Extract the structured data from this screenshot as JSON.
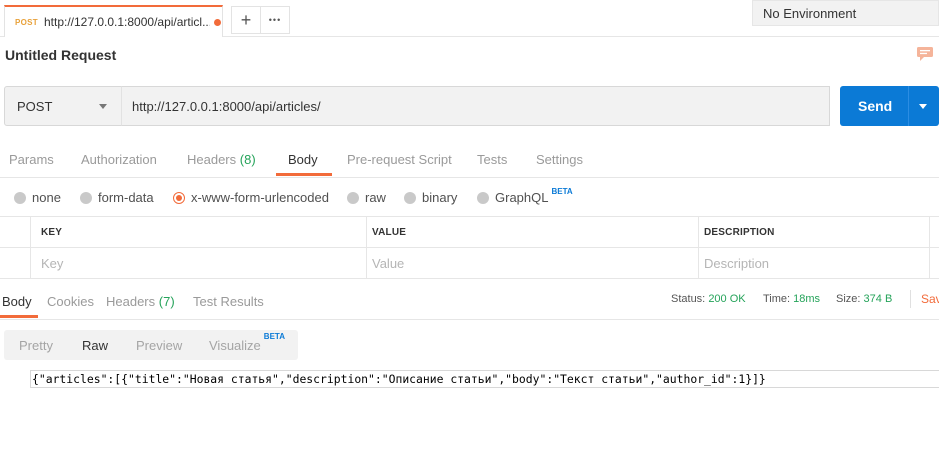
{
  "tab": {
    "method": "POST",
    "url": "http://127.0.0.1:8000/api/articl..."
  },
  "tab_actions": {
    "new_tab": "+",
    "more": "•••"
  },
  "environment": "No Environment",
  "request": {
    "title": "Untitled Request",
    "method": "POST",
    "url": "http://127.0.0.1:8000/api/articles/",
    "send_label": "Send"
  },
  "request_tabs": {
    "params": "Params",
    "authorization": "Authorization",
    "headers": "Headers",
    "headers_count": "(8)",
    "body": "Body",
    "prerequest": "Pre-request Script",
    "tests": "Tests",
    "settings": "Settings"
  },
  "body_types": {
    "none": "none",
    "form_data": "form-data",
    "urlencoded": "x-www-form-urlencoded",
    "raw": "raw",
    "binary": "binary",
    "graphql": "GraphQL",
    "beta": "BETA",
    "selected": "x-www-form-urlencoded"
  },
  "params_table": {
    "headers": {
      "key": "KEY",
      "value": "VALUE",
      "description": "DESCRIPTION"
    },
    "placeholders": {
      "key": "Key",
      "value": "Value",
      "description": "Description"
    }
  },
  "response_tabs": {
    "body": "Body",
    "cookies": "Cookies",
    "headers": "Headers",
    "headers_count": "(7)",
    "test_results": "Test Results"
  },
  "response_status": {
    "status_label": "Status:",
    "status_value": "200 OK",
    "time_label": "Time:",
    "time_value": "18ms",
    "size_label": "Size:",
    "size_value": "374 B",
    "save": "Sav"
  },
  "format_tabs": {
    "pretty": "Pretty",
    "raw": "Raw",
    "preview": "Preview",
    "visualize": "Visualize",
    "beta": "BETA"
  },
  "response_body": "{\"articles\":[{\"title\":\"Новая статья\",\"description\":\"Описание статьи\",\"body\":\"Текст статьи\",\"author_id\":1}]}",
  "colors": {
    "accent": "#f26b3a",
    "send": "#0b7ad6",
    "success": "#25a35a"
  }
}
